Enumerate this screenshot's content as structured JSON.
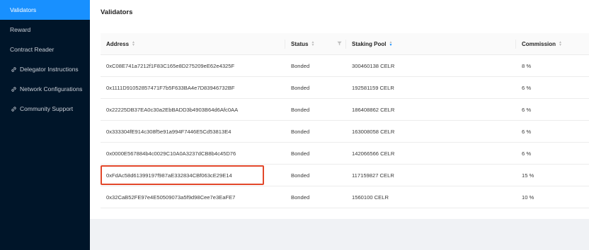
{
  "sidebar": {
    "items": [
      {
        "label": "Validators"
      },
      {
        "label": "Reward"
      },
      {
        "label": "Contract Reader"
      },
      {
        "label": "Delegator Instructions"
      },
      {
        "label": "Network Configurations"
      },
      {
        "label": "Community Support"
      }
    ]
  },
  "main": {
    "title": "Validators",
    "table": {
      "headers": {
        "address": "Address",
        "status": "Status",
        "staking_pool": "Staking Pool",
        "commission": "Commission"
      },
      "rows": [
        {
          "address": "0xC08E741a7212f1F83C165e8D275209eE62e4325F",
          "status": "Bonded",
          "staking_pool": "300460138 CELR",
          "commission": "8 %"
        },
        {
          "address": "0x1111D91052857471F7b5F633BA4e7D83946732BF",
          "status": "Bonded",
          "staking_pool": "192581159 CELR",
          "commission": "6 %"
        },
        {
          "address": "0x22225DB37EA0c30a2EbBADD3b4903B64d6Afc0AA",
          "status": "Bonded",
          "staking_pool": "186408862 CELR",
          "commission": "6 %"
        },
        {
          "address": "0x333304fE914c308f5e91a994F7446E5Cd53813E4",
          "status": "Bonded",
          "staking_pool": "163008058 CELR",
          "commission": "6 %"
        },
        {
          "address": "0x0000E567884b4c0029C10A0A3237dCB8b4c45D76",
          "status": "Bonded",
          "staking_pool": "142066566 CELR",
          "commission": "6 %"
        },
        {
          "address": "0xFdAc58d61399197f987aE332834CBf063cE29E14",
          "status": "Bonded",
          "staking_pool": "117159827 CELR",
          "commission": "15 %"
        },
        {
          "address": "0x32CaB52FE97e4E50509073a5f9d98Cee7e3EaFE7",
          "status": "Bonded",
          "staking_pool": "1560100 CELR",
          "commission": "10 %"
        }
      ]
    }
  },
  "colors": {
    "sidebar_bg": "#001529",
    "accent": "#1890ff",
    "highlight_box": "#e2472a"
  }
}
